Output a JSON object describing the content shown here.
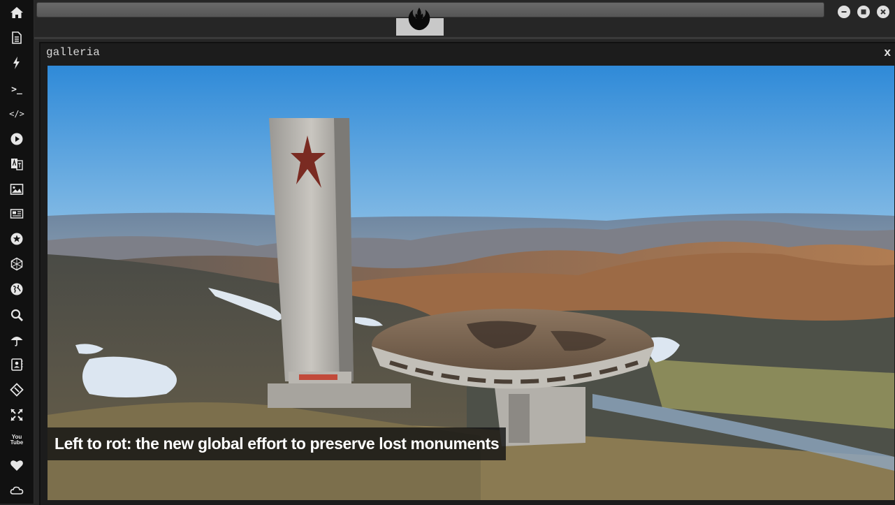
{
  "sidebar": {
    "items": [
      {
        "name": "home-icon"
      },
      {
        "name": "document-icon"
      },
      {
        "name": "bolt-icon"
      },
      {
        "name": "terminal-icon",
        "text": ">_"
      },
      {
        "name": "code-icon",
        "text": "</>"
      },
      {
        "name": "play-icon"
      },
      {
        "name": "translate-icon"
      },
      {
        "name": "image-icon"
      },
      {
        "name": "newspaper-icon"
      },
      {
        "name": "star-circle-icon"
      },
      {
        "name": "hexagon-icon"
      },
      {
        "name": "globe-icon"
      },
      {
        "name": "search-icon"
      },
      {
        "name": "umbrella-icon"
      },
      {
        "name": "contact-book-icon"
      },
      {
        "name": "git-diamond-icon"
      },
      {
        "name": "expand-icon"
      },
      {
        "name": "youtube-icon",
        "text": "You Tube"
      },
      {
        "name": "heart-icon"
      },
      {
        "name": "cloud-icon"
      }
    ]
  },
  "topbar": {
    "logo": "rebel-alliance-icon",
    "window_controls": [
      "minimize-icon",
      "maximize-icon",
      "close-icon"
    ]
  },
  "window": {
    "title": "galleria",
    "close_label": "x"
  },
  "gallery": {
    "caption": "Left to rot: the new global effort to preserve lost monuments"
  },
  "colors": {
    "sidebar_bg": "#111111",
    "window_bg": "#1c1c1c",
    "sky_top": "#2f8ad8",
    "sky_horizon": "#e9d6c4"
  }
}
